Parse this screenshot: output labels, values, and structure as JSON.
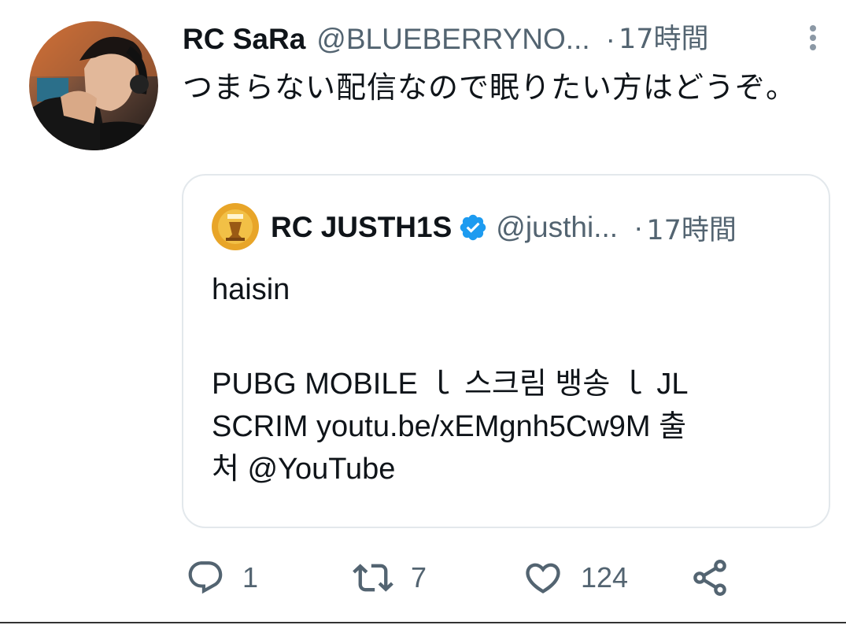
{
  "tweet": {
    "display_name": "RC SaRa",
    "handle": "@BLUEBERRYNO...",
    "separator": "·",
    "time": "17時間",
    "text": "つまらない配信なので眠りたい方はどうぞ。",
    "avatar_icon": "user-avatar-photo",
    "more_icon": "more-vertical-icon"
  },
  "quote": {
    "display_name": "RC JUSTH1S",
    "handle": "@justhi...",
    "separator": "·",
    "time": "17時間",
    "verified_icon": "verified-badge-icon",
    "avatar_icon": "user-avatar-logo",
    "lines": [
      "haisin",
      "PUBG MOBILE ｌ 스크림 뱅송 ｌ JL",
      "SCRIM youtu.be/xEMgnh5Cw9M 출",
      "처 @YouTube"
    ]
  },
  "actions": {
    "reply": {
      "icon": "reply-icon",
      "count": "1"
    },
    "retweet": {
      "icon": "retweet-icon",
      "count": "7"
    },
    "like": {
      "icon": "heart-icon",
      "count": "124"
    },
    "share": {
      "icon": "share-icon"
    }
  },
  "colors": {
    "text": "#0f1419",
    "secondary": "#536471",
    "border": "#e3e8ec",
    "verified": "#1d9bf0"
  }
}
